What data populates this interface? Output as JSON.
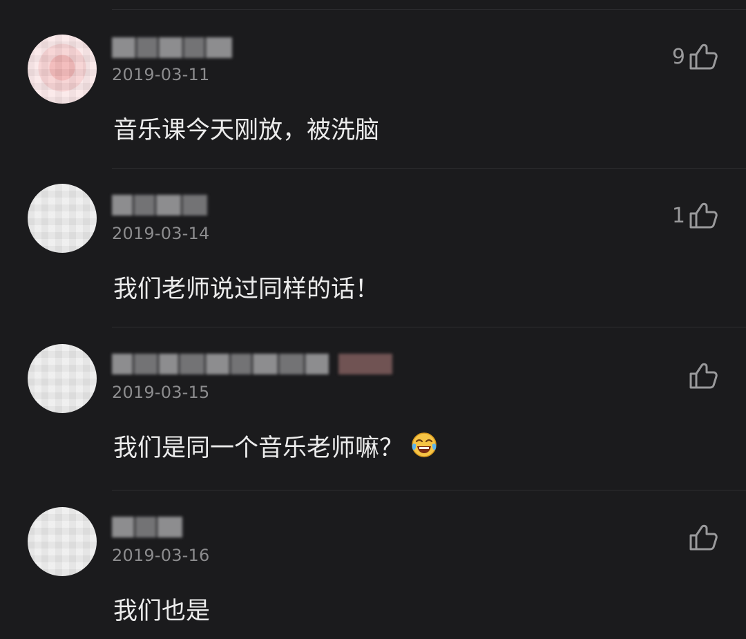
{
  "comments": [
    {
      "date": "2019-03-11",
      "text": "音乐课今天刚放，被洗脑",
      "likes": "9",
      "avatar_icon": "avatar-pink-icon"
    },
    {
      "date": "2019-03-14",
      "text": "我们老师说过同样的话！",
      "likes": "1",
      "avatar_icon": "avatar-white-icon"
    },
    {
      "date": "2019-03-15",
      "text": "我们是同一个音乐老师嘛？",
      "emoji": "tears-of-joy-emoji",
      "likes": "",
      "avatar_icon": "avatar-white-icon"
    },
    {
      "date": "2019-03-16",
      "text": "我们也是",
      "likes": "",
      "avatar_icon": "avatar-white-icon"
    }
  ],
  "icons": {
    "like": "thumbs-up-icon"
  },
  "colors": {
    "background": "#1b1b1d",
    "text": "#ececec",
    "muted": "#8c8c8e",
    "divider": "#2e2e31"
  }
}
